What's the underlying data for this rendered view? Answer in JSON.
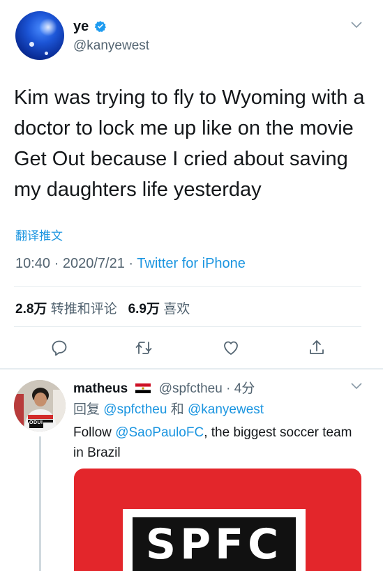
{
  "main_tweet": {
    "name": "ye",
    "handle": "@kanyewest",
    "text": "Kim was trying to fly to Wyoming with a doctor to lock me up like on the movie Get Out because I cried about saving my daughters life yesterday",
    "translate_label": "翻译推文",
    "time": "10:40",
    "date": "2020/7/21",
    "separator": "·",
    "source": "Twitter for iPhone",
    "retweets_count": "2.8万",
    "retweets_label": "转推和评论",
    "likes_count": "6.9万",
    "likes_label": "喜欢"
  },
  "reply": {
    "name": "matheus",
    "handle": "@spfctheu",
    "time_ago": "4分",
    "replying_label": "回复",
    "replying_to_1": "@spfctheu",
    "and_label": "和",
    "replying_to_2": "@kanyewest",
    "text_before": "Follow ",
    "mention": "@SaoPauloFC",
    "text_after": ", the biggest soccer team in Brazil",
    "media_logo_text": "SPFC",
    "avatar_jersey_text": "ODUI"
  },
  "icons": [
    "verified-badge-icon",
    "chevron-down-icon",
    "reply-icon",
    "retweet-icon",
    "like-icon",
    "share-icon",
    "egypt-flag-icon"
  ],
  "colors": {
    "link": "#1b95e0",
    "muted": "#536471",
    "text": "#14171a",
    "verified": "#1d9bf0",
    "media_red": "#e3262b"
  }
}
